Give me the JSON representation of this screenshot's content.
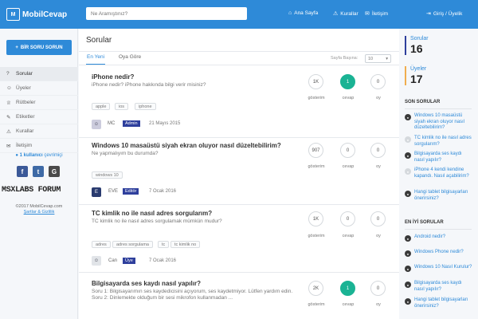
{
  "header": {
    "logo_text": "MobilCevap",
    "logo_mark": "M",
    "search_placeholder": "Ne Aramıştınız?",
    "nav": [
      {
        "icon": "⌂",
        "label": "Ana Sayfa"
      },
      {
        "icon": "⚠",
        "label": "Kurallar"
      },
      {
        "icon": "✉",
        "label": "İletişim"
      },
      {
        "icon": "⇥",
        "label": "Giriş / Üyelik"
      }
    ]
  },
  "sidebar": {
    "ask_button": "BİR SORU SORUN",
    "items": [
      {
        "icon": "?",
        "label": "Sorular"
      },
      {
        "icon": "☺",
        "label": "Üyeler"
      },
      {
        "icon": "♕",
        "label": "Rütbeler"
      },
      {
        "icon": "✎",
        "label": "Etiketler"
      },
      {
        "icon": "⚠",
        "label": "Kurallar"
      },
      {
        "icon": "✉",
        "label": "İletişim"
      }
    ],
    "online_count": "1 kullanıcı",
    "online_text": "çevrimiçi",
    "brand": "MSXLABS FORUM",
    "copyright": "©2017 MobilCevap.com",
    "terms": "Şartlar & Gizlilik"
  },
  "main": {
    "title": "Sorular",
    "tabs": [
      "En Yeni",
      "Oya Göre"
    ],
    "perpage_label": "Sayfa Başına:",
    "perpage_value": "10",
    "stat_labels": [
      "gösterim",
      "cevap",
      "oy"
    ],
    "questions": [
      {
        "title": "iPhone nedir?",
        "excerpt": "iPhone nedir? iPhone hakkında bilgi verir misiniz?",
        "tags": [
          "apple",
          "ios",
          "iphone"
        ],
        "author": "MC",
        "role": "Admin",
        "date": "21 Mayıs 2015",
        "views": "1K",
        "answers": "1",
        "votes": "0",
        "answered": true
      },
      {
        "title": "Windows 10 masaüstü siyah ekran oluyor nasıl düzeltebilirim?",
        "excerpt": "Ne yapmalıyım bu durumda?",
        "tags": [
          "windows 10"
        ],
        "author": "EVE",
        "role": "Editör",
        "date": "7 Ocak 2016",
        "views": "907",
        "answers": "0",
        "votes": "0",
        "answered": false
      },
      {
        "title": "TC kimlik no ile nasıl adres sorgularım?",
        "excerpt": "TC kimlik no ile nasıl adres sorgulamak mümkün mudur?",
        "tags": [
          "adres",
          "adres sorgulama",
          "tc",
          "tc kimlik no"
        ],
        "author": "Can",
        "role": "Üye",
        "date": "7 Ocak 2016",
        "views": "1K",
        "answers": "0",
        "votes": "0",
        "answered": false
      },
      {
        "title": "Bilgisayarda ses kaydı nasıl yapılır?",
        "excerpt": "Soru 1: Bilgisayarımın ses kaydedicisini açıyorum, ses kaydetmiyor. Lütfen yardım edin.   Soru 2: Dinlemekte olduğum bir sesi mikrofon kullanmadan ...",
        "tags": [],
        "author": "",
        "role": "",
        "date": "",
        "views": "2K",
        "answers": "1",
        "votes": "0",
        "answered": true
      }
    ]
  },
  "rightbar": {
    "stats": [
      {
        "label": "Sorular",
        "value": "16",
        "color": "#2e3f9c"
      },
      {
        "label": "Üyeler",
        "value": "17",
        "color": "#f0ad4e"
      }
    ],
    "recent_title": "SON SORULAR",
    "recent": [
      "Windows 10 masaüstü siyah ekran oluyor nasıl düzeltebilirim?",
      "TC kimlik no ile nasıl adres sorgularım?",
      "Bilgisayarda ses kaydı nasıl yapılır?",
      "iPhone 4 kendi kendine kapandı. Nasıl açabilirim?",
      "Hangi tablet bilgisayarları önerirsiniz?"
    ],
    "best_title": "EN İYİ SORULAR",
    "best": [
      "Android nedir?",
      "Windows Phone nedir?",
      "Windows 10 Nasıl Kurulur?",
      "Bilgisayarda ses kaydı nasıl yapılır?",
      "Hangi tablet bilgisayarları önerirsiniz?"
    ]
  },
  "colors": {
    "primary": "#2e8ad8",
    "answered": "#1ab394",
    "badge": "#2e3f9c"
  }
}
